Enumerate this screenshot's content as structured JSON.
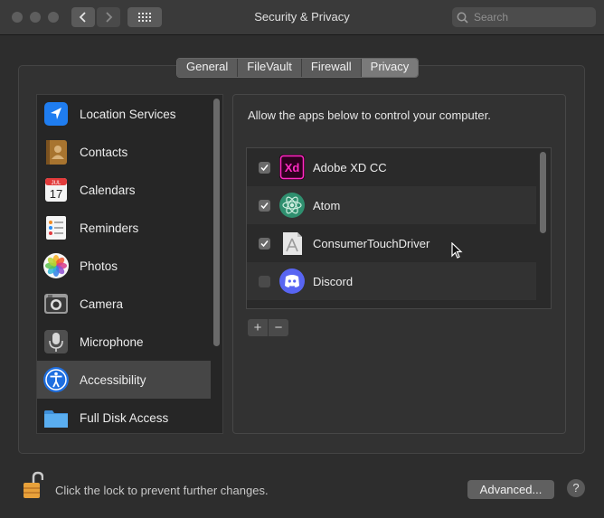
{
  "window": {
    "title": "Security & Privacy"
  },
  "search": {
    "placeholder": "Search"
  },
  "tabs": [
    {
      "label": "General",
      "selected": false
    },
    {
      "label": "FileVault",
      "selected": false
    },
    {
      "label": "Firewall",
      "selected": false
    },
    {
      "label": "Privacy",
      "selected": true
    }
  ],
  "sidebar": {
    "items": [
      {
        "label": "Location Services",
        "icon": "location-arrow-icon"
      },
      {
        "label": "Contacts",
        "icon": "contacts-book-icon"
      },
      {
        "label": "Calendars",
        "icon": "calendar-icon",
        "calendar_month": "JUL",
        "calendar_day": "17"
      },
      {
        "label": "Reminders",
        "icon": "reminders-list-icon"
      },
      {
        "label": "Photos",
        "icon": "photos-flower-icon"
      },
      {
        "label": "Camera",
        "icon": "camera-icon"
      },
      {
        "label": "Microphone",
        "icon": "microphone-icon"
      },
      {
        "label": "Accessibility",
        "icon": "accessibility-icon",
        "selected": true
      },
      {
        "label": "Full Disk Access",
        "icon": "folder-icon"
      }
    ]
  },
  "privacy": {
    "instruction": "Allow the apps below to control your computer.",
    "apps": [
      {
        "name": "Adobe XD CC",
        "checked": true,
        "icon": "adobe-xd-icon",
        "icon_text": "Xd"
      },
      {
        "name": "Atom",
        "checked": true,
        "icon": "atom-icon"
      },
      {
        "name": "ConsumerTouchDriver",
        "checked": true,
        "icon": "generic-app-icon"
      },
      {
        "name": "Discord",
        "checked": false,
        "icon": "discord-icon"
      }
    ],
    "add_label": "+",
    "remove_label": "−"
  },
  "footer": {
    "lock_text": "Click the lock to prevent further changes.",
    "advanced_label": "Advanced...",
    "help_label": "?"
  },
  "colors": {
    "background": "#2d2d2d",
    "titlebar": "#3a3a3a",
    "selected_row": "#464646",
    "xd_pink": "#ff2bc2",
    "discord_blue": "#5865f2",
    "atom_green": "#66c4a0",
    "lock_orange": "#e8a13a"
  }
}
